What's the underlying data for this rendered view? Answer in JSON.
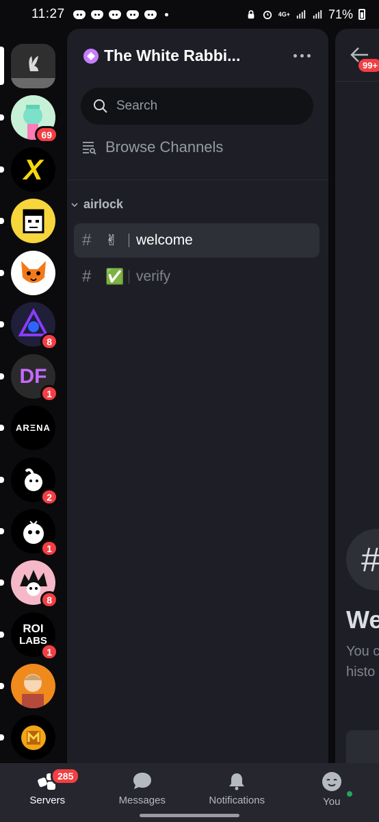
{
  "statusbar": {
    "time": "11:27",
    "network": "4G+",
    "battery": "71%"
  },
  "rail": {
    "servers": [
      {
        "name": "The White Rabbit",
        "badge": "",
        "active": true,
        "bg": "#2a2a2a"
      },
      {
        "name": "server-2",
        "badge": "69",
        "bg": "#f4a3c4"
      },
      {
        "name": "server-x",
        "badge": "",
        "bg": "#000000"
      },
      {
        "name": "server-4",
        "badge": "",
        "bg": "#f6d63c"
      },
      {
        "name": "server-5",
        "badge": "",
        "bg": "#ffffff"
      },
      {
        "name": "server-6",
        "badge": "8",
        "bg": "#1f1f3a"
      },
      {
        "name": "server-df",
        "badge": "1",
        "bg": "#2a2a2a"
      },
      {
        "name": "server-arena",
        "badge": "",
        "bg": "#000000"
      },
      {
        "name": "server-9",
        "badge": "2",
        "bg": "#000000"
      },
      {
        "name": "server-10",
        "badge": "1",
        "bg": "#000000"
      },
      {
        "name": "server-11",
        "badge": "8",
        "bg": "#f5b8c8"
      },
      {
        "name": "server-roi",
        "badge": "1",
        "bg": "#000000"
      },
      {
        "name": "server-13",
        "badge": "",
        "bg": "#f08a1d"
      },
      {
        "name": "server-14",
        "badge": "",
        "bg": "#000000"
      }
    ],
    "logo_texts": {
      "x": "X",
      "df": "DF",
      "arena": "ARΞNA",
      "roi_top": "ROI",
      "roi_bottom": "LABS"
    }
  },
  "panel": {
    "guild_name": "The White Rabbi...",
    "search_placeholder": "Search",
    "browse_label": "Browse Channels",
    "category": "airlock",
    "channels": [
      {
        "emoji": "✌",
        "name": "welcome",
        "selected": true
      },
      {
        "emoji": "✅",
        "name": "verify",
        "selected": false
      }
    ]
  },
  "chat": {
    "mention_badge": "99+",
    "welcome_fragment": "We",
    "desc_line1": "You c",
    "desc_line2": "histo"
  },
  "bottomnav": {
    "items": [
      {
        "label": "Servers",
        "badge": "285",
        "active": true
      },
      {
        "label": "Messages"
      },
      {
        "label": "Notifications"
      },
      {
        "label": "You"
      }
    ]
  },
  "colors": {
    "accent": "#f23f43",
    "panel": "#1e1f26",
    "online": "#23a55a"
  }
}
